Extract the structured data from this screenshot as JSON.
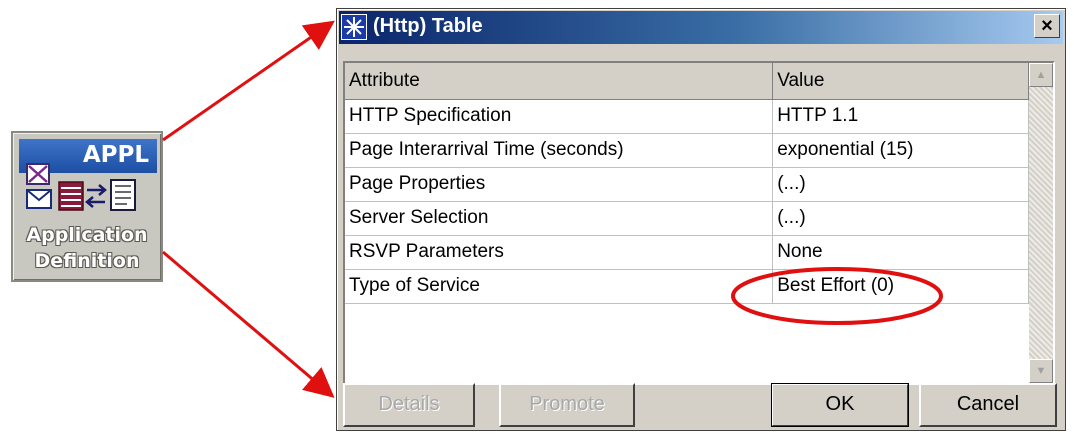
{
  "node": {
    "title": "APPL",
    "label_line1": "Application",
    "label_line2": "Definition"
  },
  "dialog": {
    "title": "(Http) Table",
    "close_glyph": "×",
    "columns": {
      "attribute": "Attribute",
      "value": "Value"
    },
    "rows": [
      {
        "attribute": "HTTP Specification",
        "value": "HTTP 1.1"
      },
      {
        "attribute": "Page Interarrival Time (seconds)",
        "value": "exponential (15)"
      },
      {
        "attribute": "Page Properties",
        "value": "(...)"
      },
      {
        "attribute": "Server Selection",
        "value": "(...)"
      },
      {
        "attribute": "RSVP Parameters",
        "value": "None"
      },
      {
        "attribute": "Type of Service",
        "value": "Best Effort (0)"
      }
    ],
    "buttons": {
      "details": "Details",
      "promote": "Promote",
      "ok": "OK",
      "cancel": "Cancel"
    }
  },
  "colors": {
    "arrow": "#e01010",
    "highlight_ellipse": "#e01010",
    "titlebar_start": "#0a246a",
    "titlebar_end": "#a6caf0"
  },
  "icons": {
    "dialog_icon": "star-burst-icon",
    "appl_icons": [
      "mail-x-icon",
      "envelope-icon",
      "database-icon",
      "transfer-arrows-icon",
      "document-icon"
    ]
  }
}
